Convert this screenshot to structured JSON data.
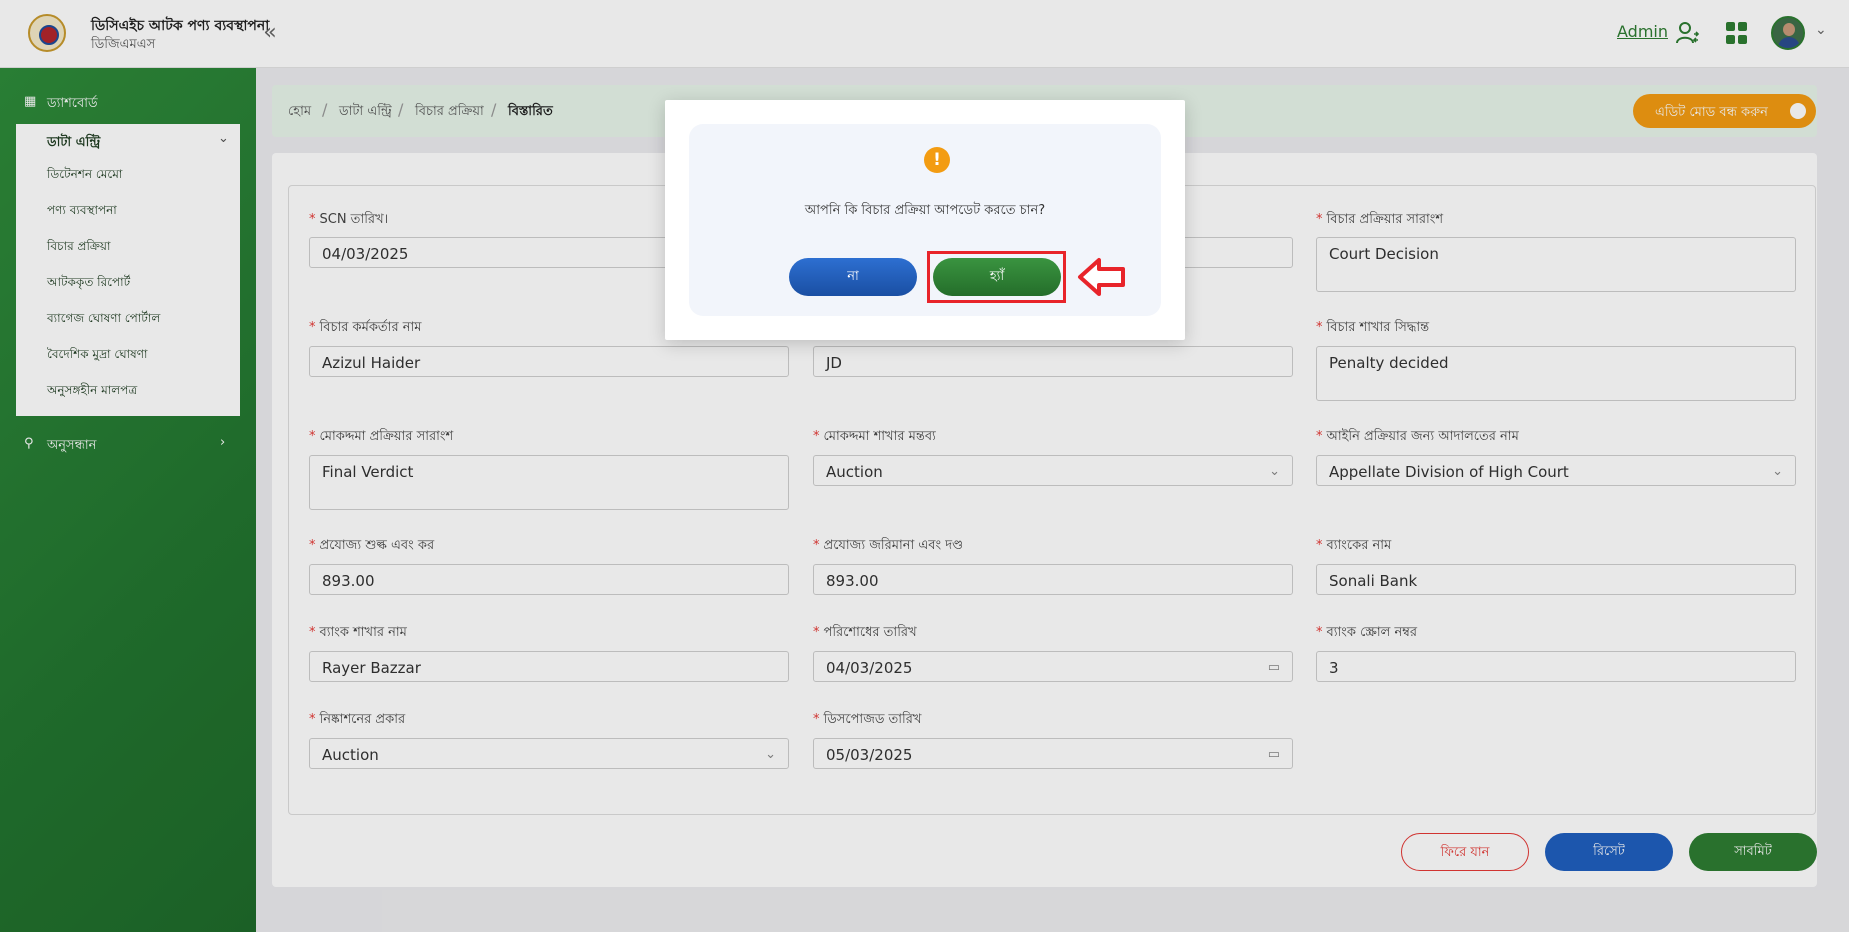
{
  "header": {
    "title": "ডিসিএইচ আটক পণ্য ব্যবস্থাপনা",
    "subtitle": "ডিজিএমএস",
    "admin_label": "Admin"
  },
  "sidebar": {
    "dashboard": "ড্যাশবোর্ড",
    "data_entry": "ডাটা এন্ট্রি",
    "sub_items": [
      "ডিটেনশন মেমো",
      "পণ্য ব্যবস্থাপনা",
      "বিচার প্রক্রিয়া",
      "আটককৃত রিপোর্ট",
      "ব্যাগেজ ঘোষণা পোর্টাল",
      "বৈদেশিক মুদ্রা ঘোষণা",
      "অনুসঙ্গহীন মালপত্র"
    ],
    "search": "অনুসন্ধান"
  },
  "breadcrumb": [
    "হোম",
    "ডাটা এন্ট্রি",
    "বিচার প্রক্রিয়া",
    "বিস্তারিত"
  ],
  "edit_mode_label": "এডিট মোড বন্ধ করুন",
  "form": {
    "scn_date_label": "SCN তারিখ।",
    "scn_date_value": "04/03/2025",
    "trial_summary_label": "বিচার প্রক্রিয়ার সারাংশ",
    "trial_summary_value": "Court Decision",
    "trial_officer_label": "বিচার কর্মকর্তার নাম",
    "trial_officer_value": "Azizul Haider",
    "field_jd_value": "JD",
    "branch_decision_label": "বিচার শাখার সিদ্ধান্ত",
    "branch_decision_value": "Penalty decided",
    "case_summary_label": "মোকদ্দমা প্রক্রিয়ার সারাংশ",
    "case_summary_value": "Final Verdict",
    "case_comment_label": "মোকদ্দমা শাখার মন্তব্য",
    "case_comment_value": "Auction",
    "court_name_label": "আইনি প্রক্রিয়ার জন্য আদালতের নাম",
    "court_name_value": "Appellate Division of High Court",
    "duty_tax_label": "প্রযোজ্য শুল্ক এবং কর",
    "duty_tax_value": "893.00",
    "fine_label": "প্রযোজ্য জরিমানা এবং দণ্ড",
    "fine_value": "893.00",
    "bank_name_label": "ব্যাংকের নাম",
    "bank_name_value": "Sonali Bank",
    "bank_branch_label": "ব্যাংক শাখার নাম",
    "bank_branch_value": "Rayer Bazzar",
    "payment_date_label": "পরিশোধের তারিখ",
    "payment_date_value": "04/03/2025",
    "bank_scroll_label": "ব্যাংক স্ক্রোল নম্বর",
    "bank_scroll_value": "3",
    "disposal_type_label": "নিষ্কাশনের প্রকার",
    "disposal_type_value": "Auction",
    "disposed_date_label": "ডিসপোজড তারিখ",
    "disposed_date_value": "05/03/2025"
  },
  "actions": {
    "back": "ফিরে যান",
    "reset": "রিসেট",
    "submit": "সাবমিট"
  },
  "modal": {
    "message": "আপনি কি বিচার প্রক্রিয়া আপডেট করতে চান?",
    "no": "না",
    "yes": "হ্যাঁ",
    "warn_glyph": "!"
  },
  "colors": {
    "brand_green": "#2e7d32",
    "accent_orange": "#f39c12",
    "primary_blue": "#1f5fbf",
    "highlight_red": "#e8242a"
  }
}
